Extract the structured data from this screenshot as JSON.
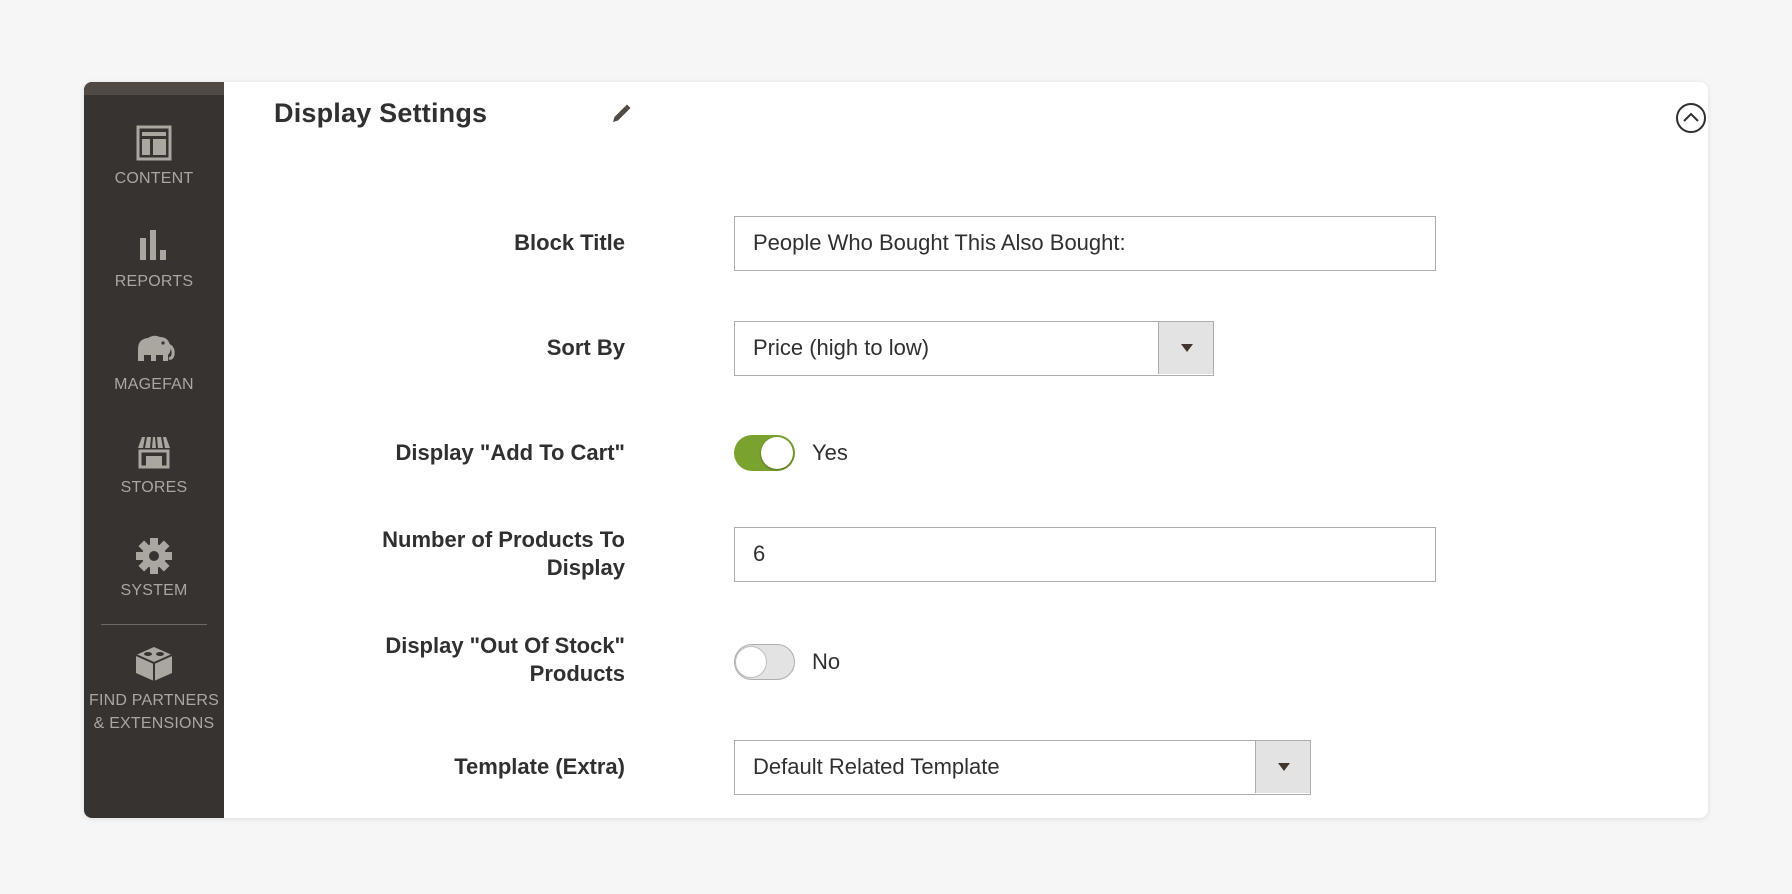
{
  "sidebar": {
    "items": [
      {
        "label": "CONTENT",
        "icon": "content-icon"
      },
      {
        "label": "REPORTS",
        "icon": "reports-icon"
      },
      {
        "label": "MAGEFAN",
        "icon": "magefan-elephant-icon"
      },
      {
        "label": "STORES",
        "icon": "stores-icon"
      },
      {
        "label": "SYSTEM",
        "icon": "gear-icon"
      },
      {
        "label": "FIND PARTNERS & EXTENSIONS",
        "icon": "partners-extensions-icon"
      }
    ]
  },
  "section": {
    "title": "Display Settings"
  },
  "fields": {
    "block_title": {
      "label": "Block Title",
      "value": "People Who Bought This Also Bought:"
    },
    "sort_by": {
      "label": "Sort By",
      "value": "Price (high to low)"
    },
    "add_to_cart": {
      "label": "Display \"Add To Cart\"",
      "value": "Yes",
      "enabled": true
    },
    "num_products": {
      "label": "Number of Products To Display",
      "value": "6"
    },
    "out_of_stock": {
      "label": "Display \"Out Of Stock\" Products",
      "value": "No",
      "enabled": false
    },
    "template": {
      "label": "Template (Extra)",
      "value": "Default Related Template"
    }
  },
  "colors": {
    "sidebar_bg": "#373330",
    "toggle_on": "#79a22e",
    "page_bg": "#f6f6f6"
  }
}
